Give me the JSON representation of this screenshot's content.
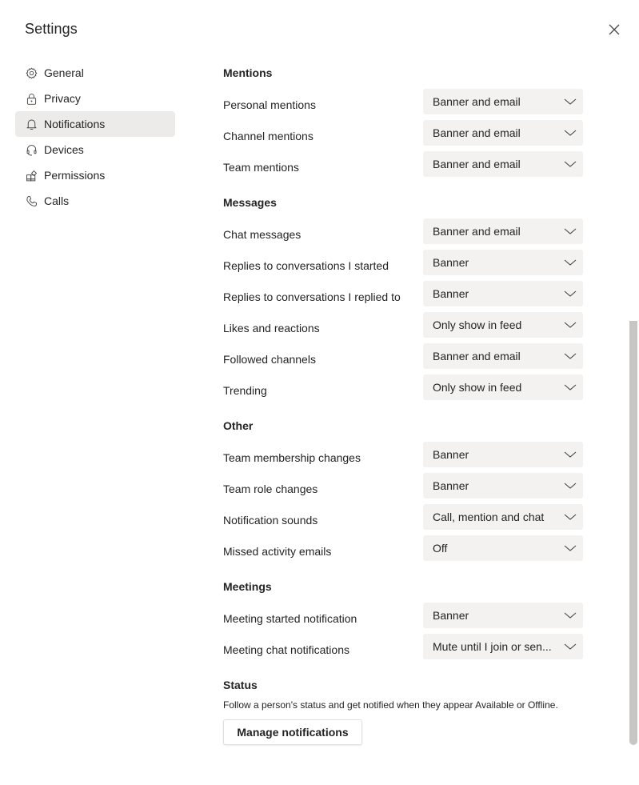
{
  "dialog": {
    "title": "Settings",
    "close_icon": "close-icon"
  },
  "sidebar": {
    "items": [
      {
        "label": "General",
        "icon": "gear-icon",
        "active": false
      },
      {
        "label": "Privacy",
        "icon": "lock-icon",
        "active": false
      },
      {
        "label": "Notifications",
        "icon": "bell-icon",
        "active": true
      },
      {
        "label": "Devices",
        "icon": "headset-icon",
        "active": false
      },
      {
        "label": "Permissions",
        "icon": "apps-icon",
        "active": false
      },
      {
        "label": "Calls",
        "icon": "phone-icon",
        "active": false
      }
    ]
  },
  "sections": {
    "mentions": {
      "title": "Mentions",
      "rows": [
        {
          "label": "Personal mentions",
          "value": "Banner and email"
        },
        {
          "label": "Channel mentions",
          "value": "Banner and email"
        },
        {
          "label": "Team mentions",
          "value": "Banner and email"
        }
      ]
    },
    "messages": {
      "title": "Messages",
      "rows": [
        {
          "label": "Chat messages",
          "value": "Banner and email"
        },
        {
          "label": "Replies to conversations I started",
          "value": "Banner"
        },
        {
          "label": "Replies to conversations I replied to",
          "value": "Banner"
        },
        {
          "label": "Likes and reactions",
          "value": "Only show in feed"
        },
        {
          "label": "Followed channels",
          "value": "Banner and email"
        },
        {
          "label": "Trending",
          "value": "Only show in feed"
        }
      ]
    },
    "other": {
      "title": "Other",
      "rows": [
        {
          "label": "Team membership changes",
          "value": "Banner"
        },
        {
          "label": "Team role changes",
          "value": "Banner"
        },
        {
          "label": "Notification sounds",
          "value": "Call, mention and chat"
        },
        {
          "label": "Missed activity emails",
          "value": "Off"
        }
      ]
    },
    "meetings": {
      "title": "Meetings",
      "rows": [
        {
          "label": "Meeting started notification",
          "value": "Banner"
        },
        {
          "label": "Meeting chat notifications",
          "value": "Mute until I join or sen..."
        }
      ]
    },
    "status": {
      "title": "Status",
      "description": "Follow a person's status and get notified when they appear Available or Offline.",
      "button_label": "Manage notifications"
    }
  },
  "colors": {
    "active_nav_bg": "#edebe9",
    "dropdown_bg": "#f3f2f1",
    "text": "#252423",
    "scrollbar": "#c8c6c4"
  }
}
